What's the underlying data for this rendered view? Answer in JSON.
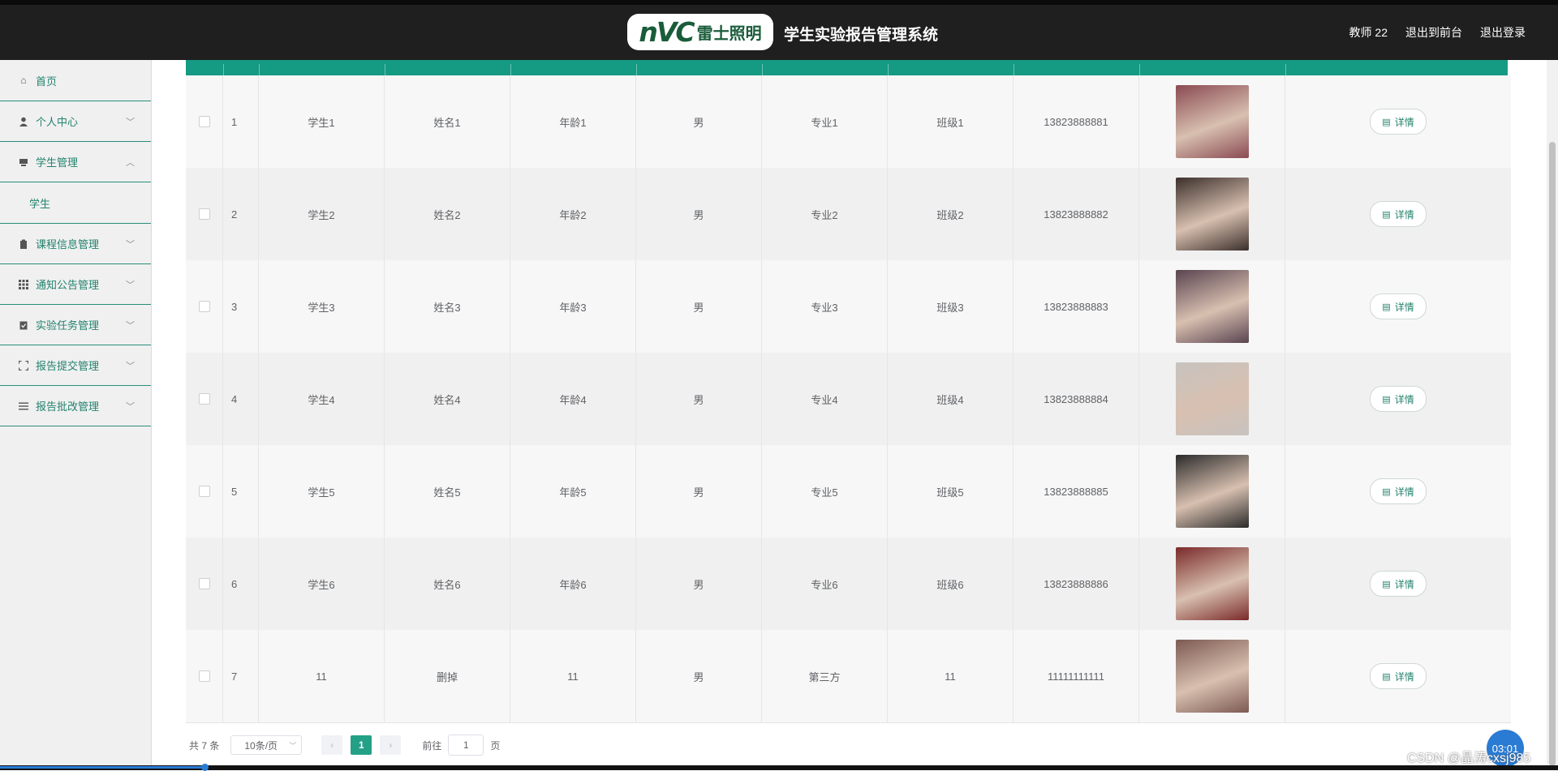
{
  "header": {
    "logo_mark": "nVC",
    "logo_cn": "雷士照明",
    "system_title": "学生实验报告管理系统",
    "user_label": "教师 22",
    "to_front_label": "退出到前台",
    "logout_label": "退出登录"
  },
  "sidebar": {
    "items": [
      {
        "label": "首页",
        "icon": "home-icon"
      },
      {
        "label": "个人中心",
        "icon": "user-icon"
      },
      {
        "label": "学生管理",
        "icon": "monitor-icon",
        "expanded": true,
        "children": [
          {
            "label": "学生"
          }
        ]
      },
      {
        "label": "课程信息管理",
        "icon": "clipboard-icon"
      },
      {
        "label": "通知公告管理",
        "icon": "grid-icon"
      },
      {
        "label": "实验任务管理",
        "icon": "task-icon"
      },
      {
        "label": "报告提交管理",
        "icon": "fullscreen-icon"
      },
      {
        "label": "报告批改管理",
        "icon": "list-icon"
      }
    ]
  },
  "table": {
    "rows": [
      {
        "index": "1",
        "xuehao": "学生1",
        "name": "姓名1",
        "age": "年龄1",
        "gender": "男",
        "major": "专业1",
        "clazz": "班级1",
        "phone": "13823888881",
        "photo_color": "#8a4a52",
        "action": "详情"
      },
      {
        "index": "2",
        "xuehao": "学生2",
        "name": "姓名2",
        "age": "年龄2",
        "gender": "男",
        "major": "专业2",
        "clazz": "班级2",
        "phone": "13823888882",
        "photo_color": "#3b2f2b",
        "action": "详情"
      },
      {
        "index": "3",
        "xuehao": "学生3",
        "name": "姓名3",
        "age": "年龄3",
        "gender": "男",
        "major": "专业3",
        "clazz": "班级3",
        "phone": "13823888883",
        "photo_color": "#5a4450",
        "action": "详情"
      },
      {
        "index": "4",
        "xuehao": "学生4",
        "name": "姓名4",
        "age": "年龄4",
        "gender": "男",
        "major": "专业4",
        "clazz": "班级4",
        "phone": "13823888884",
        "photo_color": "#c7c3bf",
        "action": "详情"
      },
      {
        "index": "5",
        "xuehao": "学生5",
        "name": "姓名5",
        "age": "年龄5",
        "gender": "男",
        "major": "专业5",
        "clazz": "班级5",
        "phone": "13823888885",
        "photo_color": "#2b2b2b",
        "action": "详情"
      },
      {
        "index": "6",
        "xuehao": "学生6",
        "name": "姓名6",
        "age": "年龄6",
        "gender": "男",
        "major": "专业6",
        "clazz": "班级6",
        "phone": "13823888886",
        "photo_color": "#7a2a2a",
        "action": "详情"
      },
      {
        "index": "7",
        "xuehao": "11",
        "name": "删掉",
        "age": "11",
        "gender": "男",
        "major": "第三方",
        "clazz": "11",
        "phone": "11111111111",
        "photo_color": "#7d5a52",
        "action": "详情"
      }
    ]
  },
  "pagination": {
    "total_text": "共 7 条",
    "page_size": "10条/页",
    "current_page": "1",
    "goto_label": "前往",
    "goto_value": "1",
    "page_unit": "页"
  },
  "overlay": {
    "timer": "03:01",
    "watermark": "CSDN @晶涛cxsj985"
  },
  "colors": {
    "accent": "#159a83",
    "topbar": "#1f1f1f",
    "menu_text": "#23826d"
  }
}
